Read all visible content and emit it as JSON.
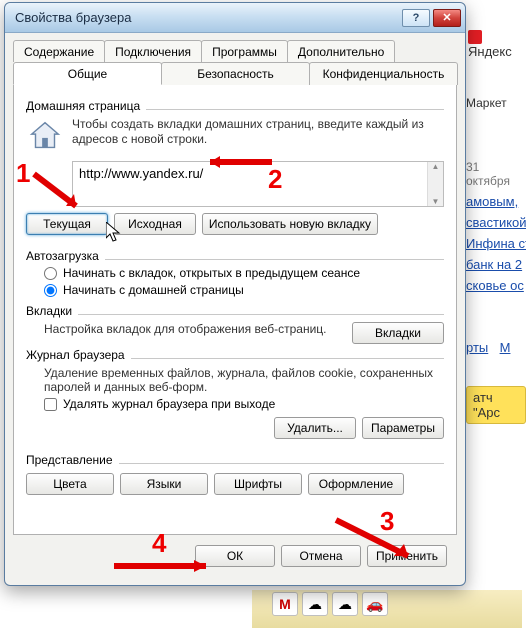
{
  "dialog": {
    "title": "Свойства браузера",
    "min_icon": "?",
    "close_icon": "✕",
    "tabs_row1": [
      {
        "label": "Содержание"
      },
      {
        "label": "Подключения"
      },
      {
        "label": "Программы"
      },
      {
        "label": "Дополнительно"
      }
    ],
    "tabs_row2": [
      {
        "label": "Общие",
        "active": true
      },
      {
        "label": "Безопасность"
      },
      {
        "label": "Конфиденциальность"
      }
    ],
    "homepage": {
      "group": "Домашняя страница",
      "help": "Чтобы создать вкладки домашних страниц, введите каждый из адресов с новой строки.",
      "url": "http://www.yandex.ru/",
      "buttons": {
        "current": "Текущая",
        "default": "Исходная",
        "newtab": "Использовать новую вкладку"
      }
    },
    "autostart": {
      "group": "Автозагрузка",
      "opt_tabs": "Начинать с вкладок, открытых в предыдущем сеансе",
      "opt_home": "Начинать с домашней страницы",
      "selected": "home"
    },
    "tabs_section": {
      "group": "Вкладки",
      "help": "Настройка вкладок для отображения веб-страниц.",
      "button": "Вкладки"
    },
    "history": {
      "group": "Журнал браузера",
      "help": "Удаление временных файлов, журнала, файлов cookie, сохраненных паролей и данных веб-форм.",
      "check_label": "Удалять журнал браузера при выходе",
      "checked": false,
      "delete_btn": "Удалить...",
      "params_btn": "Параметры"
    },
    "appearance": {
      "group": "Представление",
      "colors": "Цвета",
      "langs": "Языки",
      "fonts": "Шрифты",
      "format": "Оформление"
    },
    "footer": {
      "ok": "ОК",
      "cancel": "Отмена",
      "apply": "Применить"
    }
  },
  "annotations": {
    "n1": "1",
    "n2": "2",
    "n3": "3",
    "n4": "4"
  },
  "background": {
    "yandex": "Яндекс",
    "market": "Маркет",
    "date": "31 октября",
    "links": [
      "амовым,",
      "свастикой",
      "Инфина ст",
      "банк на 2",
      "сковье ос"
    ],
    "tabs": [
      "рты",
      "М"
    ],
    "yellow": "атч \"Арс"
  }
}
